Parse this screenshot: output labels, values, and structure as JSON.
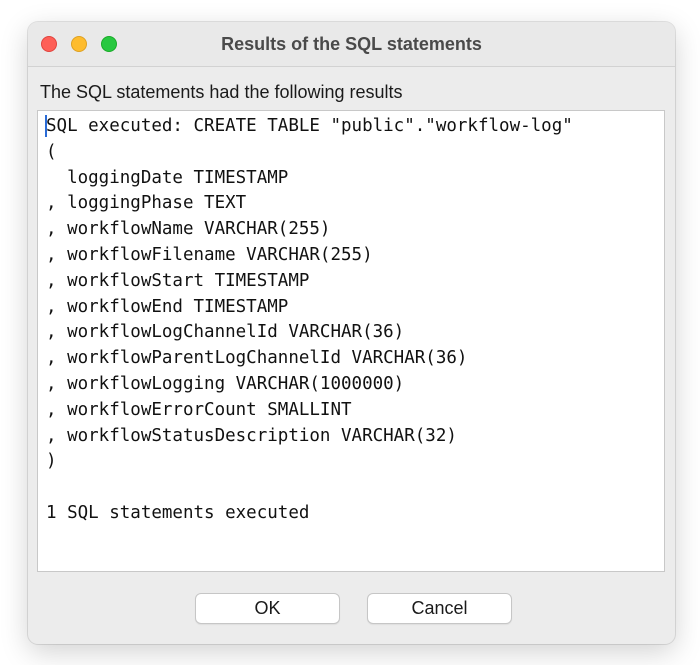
{
  "window": {
    "title": "Results of the SQL statements"
  },
  "dialog": {
    "message": "The SQL statements had the following results",
    "results_text": "SQL executed: CREATE TABLE \"public\".\"workflow-log\"\n(\n  loggingDate TIMESTAMP\n, loggingPhase TEXT\n, workflowName VARCHAR(255)\n, workflowFilename VARCHAR(255)\n, workflowStart TIMESTAMP\n, workflowEnd TIMESTAMP\n, workflowLogChannelId VARCHAR(36)\n, workflowParentLogChannelId VARCHAR(36)\n, workflowLogging VARCHAR(1000000)\n, workflowErrorCount SMALLINT\n, workflowStatusDescription VARCHAR(32)\n)\n\n1 SQL statements executed"
  },
  "buttons": {
    "ok_label": "OK",
    "cancel_label": "Cancel"
  },
  "colors": {
    "close": "#fe5f57",
    "minimize": "#febc2e",
    "maximize": "#28c840",
    "caret": "#2a6bd6"
  }
}
